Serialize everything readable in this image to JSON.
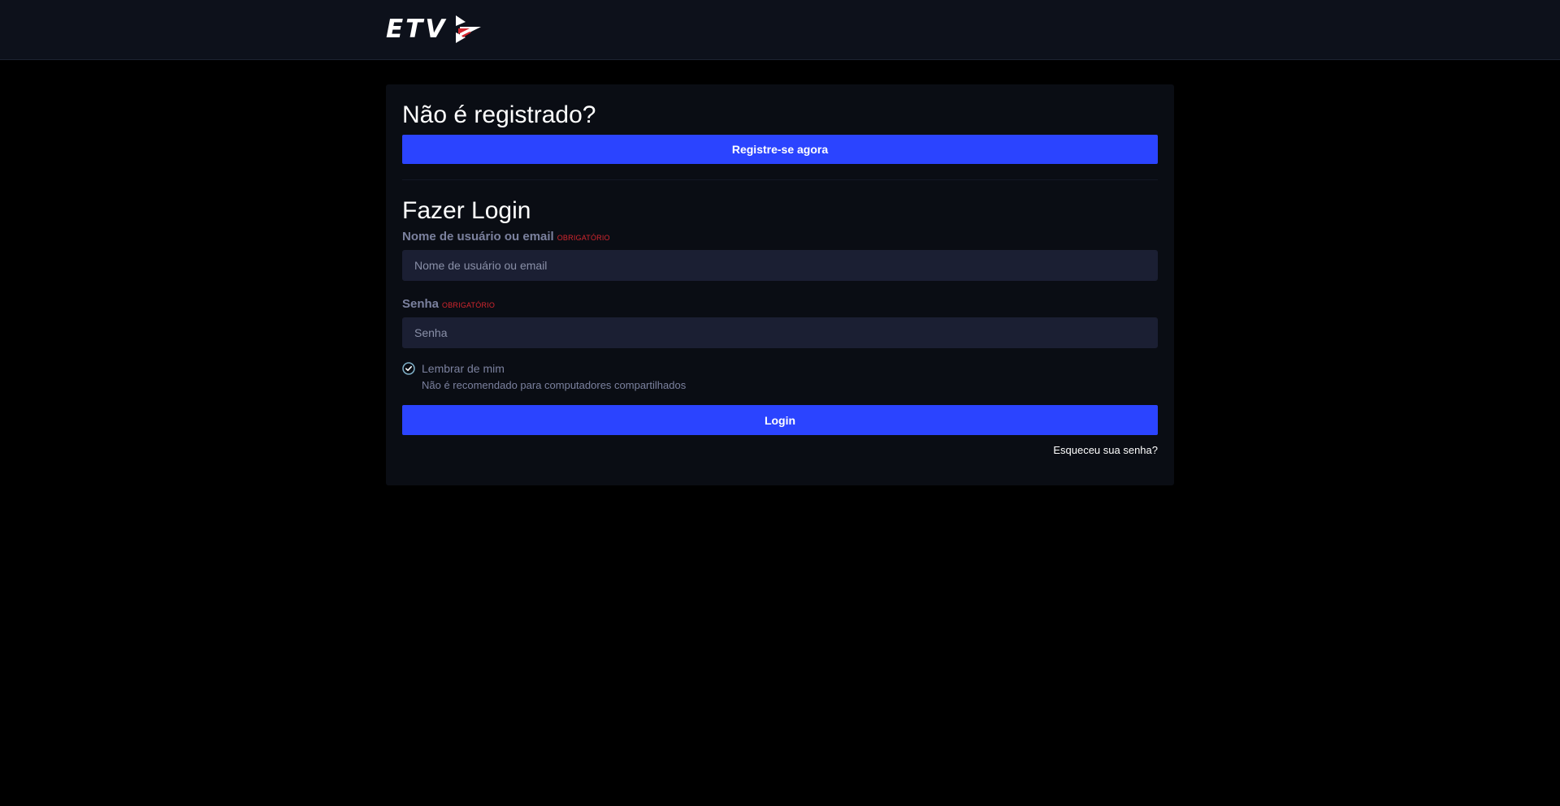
{
  "header": {
    "logo_text": "ETV",
    "logo_mark_icon": "play-arrow-logo-icon"
  },
  "register": {
    "heading": "Não é registrado?",
    "button_label": "Registre-se agora"
  },
  "login": {
    "heading": "Fazer Login",
    "username": {
      "label": "Nome de usuário ou email",
      "required_tag": "OBRIGATÓRIO",
      "placeholder": "Nome de usuário ou email",
      "value": ""
    },
    "password": {
      "label": "Senha",
      "required_tag": "OBRIGATÓRIO",
      "placeholder": "Senha",
      "value": ""
    },
    "remember": {
      "label": "Lembrar de mim",
      "hint": "Não é recomendado para computadores compartilhados",
      "checked": true,
      "icon": "check-circle-icon"
    },
    "button_label": "Login",
    "forgot_label": "Esqueceu sua senha?"
  },
  "colors": {
    "accent": "#2b44ff",
    "required": "#d3262e",
    "topbar_bg": "#0d111b",
    "card_bg": "#0a0d14",
    "input_bg": "#1b1f33",
    "page_bg": "#000000"
  }
}
